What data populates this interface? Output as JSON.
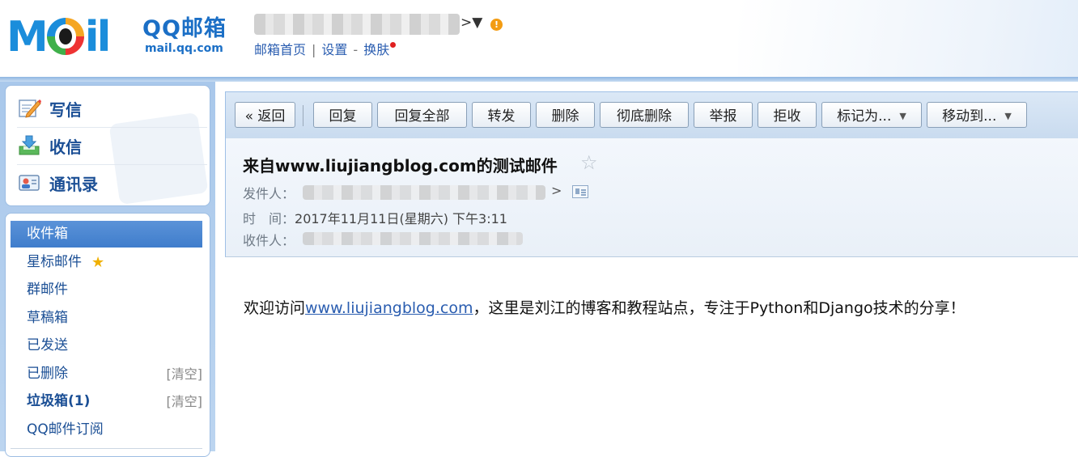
{
  "brand": {
    "logo_mail": "MAIL",
    "logo_qq": "QQ邮箱",
    "logo_url": "mail.qq.com"
  },
  "account": {
    "arrow": ">▼",
    "warn": "!"
  },
  "top_links": {
    "home": "邮箱首页",
    "sep1": "|",
    "settings": "设置",
    "sep2": "-",
    "skin": "换肤"
  },
  "quick_actions": [
    {
      "label": "写信",
      "icon": "write-icon"
    },
    {
      "label": "收信",
      "icon": "inbox-download-icon"
    },
    {
      "label": "通讯录",
      "icon": "contacts-card-icon"
    }
  ],
  "folders": [
    {
      "label": "收件箱",
      "active": true
    },
    {
      "label": "星标邮件",
      "icon": "star-icon"
    },
    {
      "label": "群邮件"
    },
    {
      "label": "草稿箱"
    },
    {
      "label": "已发送"
    },
    {
      "label": "已删除",
      "action": "[清空]"
    },
    {
      "label": "垃圾箱(1)",
      "bold": true,
      "action": "[清空]"
    },
    {
      "label": "QQ邮件订阅"
    }
  ],
  "toolbar": {
    "back": "« 返回",
    "reply": "回复",
    "reply_all": "回复全部",
    "forward": "转发",
    "delete": "删除",
    "delete_forever": "彻底删除",
    "report": "举报",
    "reject": "拒收",
    "mark_as": "标记为...",
    "move_to": "移动到...",
    "dropdown_glyph": "▼"
  },
  "mail": {
    "subject": "来自www.liujiangblog.com的测试邮件",
    "star": "☆",
    "from_label": "发件人：",
    "from_arrow": ">",
    "time_label": "时　间：",
    "time_value": "2017年11月11日(星期六) 下午3:11",
    "to_label": "收件人：",
    "body_prefix": "欢迎访问",
    "body_link": "www.liujiangblog.com",
    "body_suffix": "，这里是刘江的博客和教程站点，专注于Python和Django技术的分享！"
  },
  "colors": {
    "accent": "#1b6fc6",
    "link": "#2a5db0",
    "active_folder": "#4a86d0",
    "warning": "#f39c12"
  }
}
